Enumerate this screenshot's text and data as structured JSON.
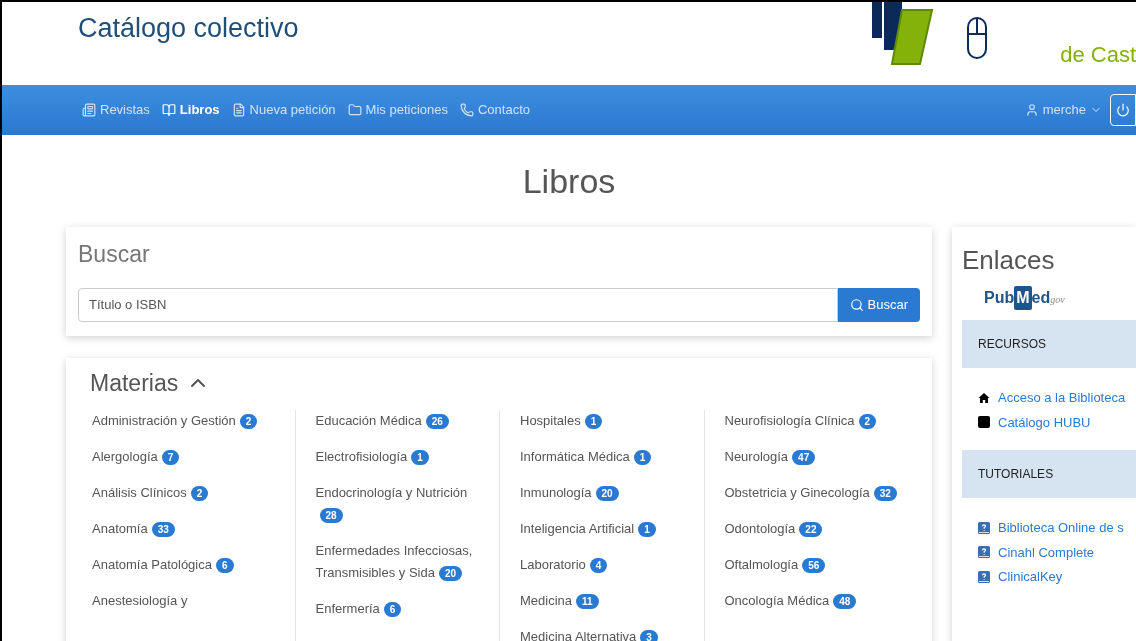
{
  "header": {
    "title": "Catálogo colectivo",
    "brand_subtitle": "de Cast"
  },
  "nav": {
    "items": [
      {
        "label": "Revistas",
        "kind": "journal",
        "selected": false
      },
      {
        "label": "Libros",
        "kind": "book",
        "selected": true
      },
      {
        "label": "Nueva petición",
        "kind": "doc",
        "selected": false
      },
      {
        "label": "Mis peticiones",
        "kind": "folder",
        "selected": false
      },
      {
        "label": "Contacto",
        "kind": "phone",
        "selected": false
      }
    ],
    "user": "merche"
  },
  "page_title": "Libros",
  "search": {
    "title": "Buscar",
    "placeholder": "Título o ISBN",
    "button": "Buscar"
  },
  "materias": {
    "title": "Materias",
    "expanded": true,
    "columns": [
      [
        {
          "name": "Administración y Gestión",
          "count": "2"
        },
        {
          "name": "Alergología",
          "count": "7"
        },
        {
          "name": "Análisis Clínicos",
          "count": "2"
        },
        {
          "name": "Anatomía",
          "count": "33"
        },
        {
          "name": "Anatomía Patológica",
          "count": "6"
        },
        {
          "name": "Anestesiología y"
        }
      ],
      [
        {
          "name": "Educación Médica",
          "count": "26"
        },
        {
          "name": "Electrofisiología",
          "count": "1"
        },
        {
          "name": "Endocrinología y Nutrición",
          "count": "28"
        },
        {
          "name": "Enfermedades Infecciosas, Transmisibles y Sida",
          "count": "20"
        },
        {
          "name": "Enfermería",
          "count": "6"
        }
      ],
      [
        {
          "name": "Hospitales",
          "count": "1"
        },
        {
          "name": "Informática Médica",
          "count": "1"
        },
        {
          "name": "Inmunología",
          "count": "20"
        },
        {
          "name": "Inteligencia Artificial",
          "count": "1"
        },
        {
          "name": "Laboratorio",
          "count": "4"
        },
        {
          "name": "Medicina",
          "count": "11"
        },
        {
          "name": "Medicina Alternativa",
          "count": "3"
        }
      ],
      [
        {
          "name": "Neurofisiología Clínica",
          "count": "2"
        },
        {
          "name": "Neurología",
          "count": "47"
        },
        {
          "name": "Obstetricia y Ginecología",
          "count": "32"
        },
        {
          "name": "Odontología",
          "count": "22"
        },
        {
          "name": "Oftalmología",
          "count": "56"
        },
        {
          "name": "Oncología Médica",
          "count": "48"
        }
      ]
    ]
  },
  "enlaces": {
    "title": "Enlaces",
    "logo": {
      "main_a": "Pub",
      "mark": "M",
      "main_b": "ed",
      "suffix": "gov"
    },
    "sections": [
      {
        "title": "RECURSOS",
        "links": [
          {
            "label": "Acceso a la Biblioteca",
            "kind": "home"
          },
          {
            "label": "Catálogo HUBU",
            "kind": "square"
          }
        ]
      },
      {
        "title": "TUTORIALES",
        "links": [
          {
            "label": "Biblioteca Online de s",
            "kind": "help"
          },
          {
            "label": "Cinahl Complete",
            "kind": "help"
          },
          {
            "label": "ClinicalKey",
            "kind": "help"
          }
        ]
      }
    ]
  }
}
